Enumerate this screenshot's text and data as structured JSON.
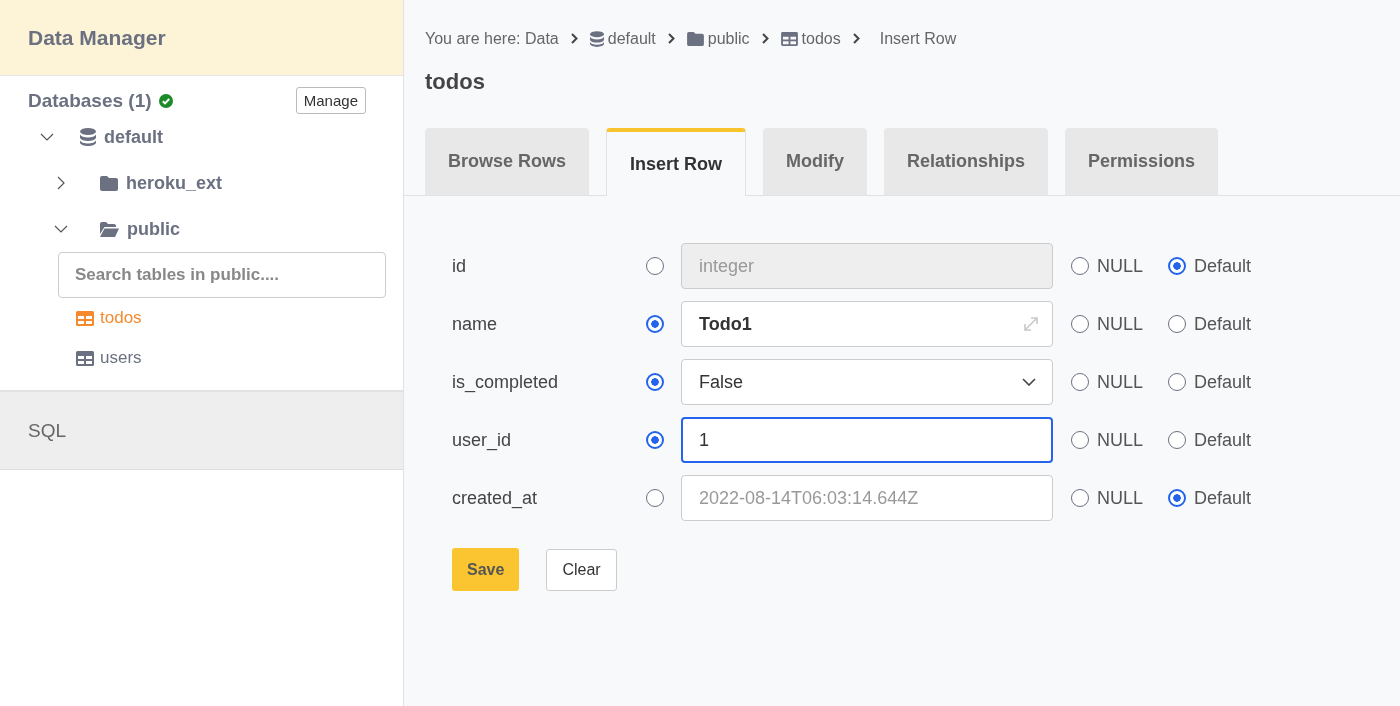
{
  "sidebar": {
    "title": "Data Manager",
    "databases_label": "Databases (1)",
    "databases_ok": true,
    "manage_button": "Manage",
    "tree": [
      {
        "kind": "database",
        "label": "default",
        "expanded": true,
        "children": [
          {
            "kind": "schema",
            "label": "heroku_ext",
            "expanded": false
          },
          {
            "kind": "schema",
            "label": "public",
            "expanded": true,
            "search": {
              "placeholder": "Search tables in public...."
            },
            "children": [
              {
                "kind": "table",
                "label": "todos",
                "selected": true
              },
              {
                "kind": "table",
                "label": "users",
                "selected": false
              }
            ]
          }
        ]
      }
    ],
    "sql_label": "SQL"
  },
  "breadcrumb": [
    {
      "kind": "text",
      "label": "You are here: Data"
    },
    {
      "kind": "database",
      "label": "default"
    },
    {
      "kind": "schema",
      "label": "public"
    },
    {
      "kind": "table",
      "label": "todos"
    },
    {
      "kind": "text",
      "label": "Insert Row"
    }
  ],
  "page_title": "todos",
  "tabs": [
    {
      "label": "Browse Rows",
      "selected": false
    },
    {
      "label": "Insert Row",
      "selected": true
    },
    {
      "label": "Modify",
      "selected": false
    },
    {
      "label": "Relationships",
      "selected": false
    },
    {
      "label": "Permissions",
      "selected": false
    }
  ],
  "rows": [
    {
      "column": "id",
      "value_selected": false,
      "field": {
        "kind": "text",
        "placeholder": "integer",
        "disabled": true,
        "focused": false
      },
      "null_label": "NULL",
      "null_selected": false,
      "default_label": "Default",
      "default_selected": true
    },
    {
      "column": "name",
      "value_selected": true,
      "field": {
        "kind": "textarea",
        "value": "Todo1",
        "disabled": false,
        "focused": false
      },
      "null_label": "NULL",
      "null_selected": false,
      "default_label": "Default",
      "default_selected": false
    },
    {
      "column": "is_completed",
      "value_selected": true,
      "field": {
        "kind": "select",
        "value": "False",
        "disabled": false,
        "focused": false
      },
      "null_label": "NULL",
      "null_selected": false,
      "default_label": "Default",
      "default_selected": false
    },
    {
      "column": "user_id",
      "value_selected": true,
      "field": {
        "kind": "text",
        "value": "1",
        "disabled": false,
        "focused": true
      },
      "null_label": "NULL",
      "null_selected": false,
      "default_label": "Default",
      "default_selected": false
    },
    {
      "column": "created_at",
      "value_selected": false,
      "field": {
        "kind": "text",
        "placeholder": "2022-08-14T06:03:14.644Z",
        "disabled": false,
        "focused": false
      },
      "null_label": "NULL",
      "null_selected": false,
      "default_label": "Default",
      "default_selected": true
    }
  ],
  "buttons": [
    {
      "kind": "primary",
      "label": "Save"
    },
    {
      "kind": "secondary",
      "label": "Clear"
    }
  ]
}
